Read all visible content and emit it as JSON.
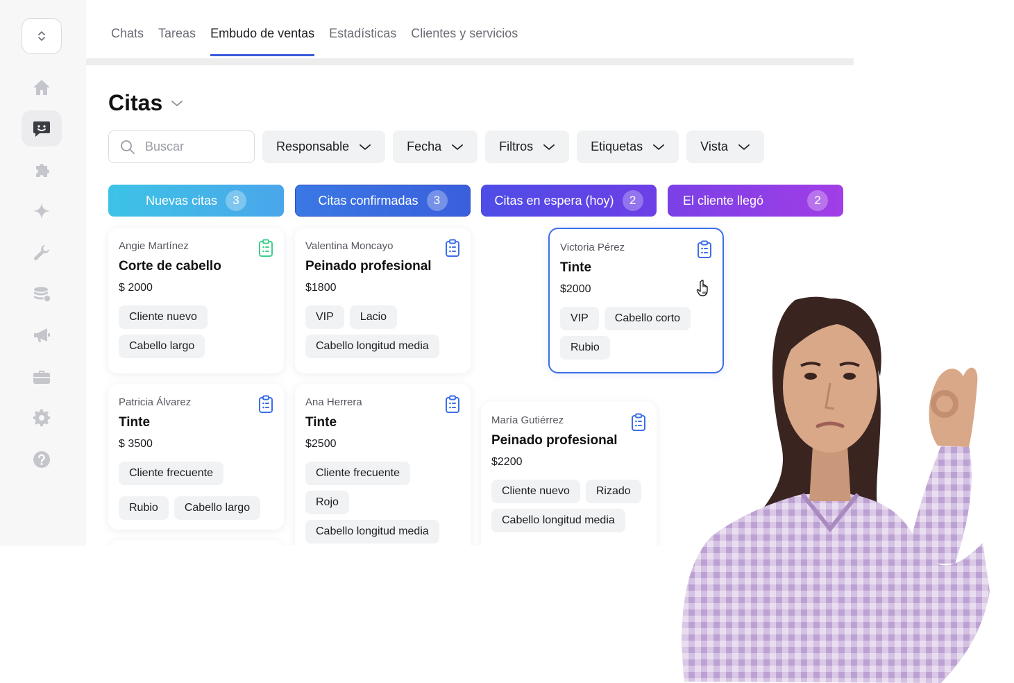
{
  "sidebar": {
    "items": [
      {
        "icon": "home-icon"
      },
      {
        "icon": "chat-icon",
        "active": true
      },
      {
        "icon": "puzzle-icon"
      },
      {
        "icon": "sparkle-icon"
      },
      {
        "icon": "wrench-icon"
      },
      {
        "icon": "coins-icon"
      },
      {
        "icon": "megaphone-icon"
      },
      {
        "icon": "briefcase-icon"
      },
      {
        "icon": "gear-icon"
      },
      {
        "icon": "help-icon"
      }
    ]
  },
  "tabs": [
    {
      "label": "Chats"
    },
    {
      "label": "Tareas"
    },
    {
      "label": "Embudo de ventas",
      "active": true
    },
    {
      "label": "Estadísticas"
    },
    {
      "label": "Clientes y servicios"
    }
  ],
  "page": {
    "title": "Citas"
  },
  "search": {
    "placeholder": "Buscar"
  },
  "filters": [
    "Responsable",
    "Fecha",
    "Filtros",
    "Etiquetas",
    "Vista"
  ],
  "columns": [
    {
      "title": "Nuevas citas",
      "count": "3",
      "color": "#3ec0e4"
    },
    {
      "title": "Citas confirmadas",
      "count": "3",
      "color": "#3a6fe0"
    },
    {
      "title": "Citas en espera (hoy)",
      "count": "2",
      "color": "#5a46e6"
    },
    {
      "title": "El cliente llegó",
      "count": "2",
      "color": "#8e3ee6"
    }
  ],
  "cards": [
    {
      "client": "Angie Martínez",
      "service": "Corte de cabello",
      "price": "$ 2000",
      "tags": [
        "Cliente nuevo",
        "Cabello largo"
      ],
      "clip_color": "#3ecf8e"
    },
    {
      "client": "Valentina Moncayo",
      "service": "Peinado profesional",
      "price": "$1800",
      "tags": [
        "VIP",
        "Lacio",
        "Cabello longitud media"
      ],
      "clip_color": "#3b6ee8"
    },
    {
      "client": "Victoria Pérez",
      "service": "Tinte",
      "price": "$2000",
      "tags": [
        "VIP",
        "Cabello corto",
        "Rubio"
      ],
      "clip_color": "#3b6ee8"
    },
    {
      "client": "Patricia Álvarez",
      "service": "Tinte",
      "price": "$ 3500",
      "tags": [
        "Cliente frecuente",
        "Rubio",
        "Cabello largo"
      ],
      "clip_color": "#3b6ee8"
    },
    {
      "client": "Ana Herrera",
      "service": "Tinte",
      "price": "$2500",
      "tags": [
        "Cliente frecuente",
        "Rojo",
        "Cabello longitud media"
      ],
      "clip_color": "#3b6ee8"
    },
    {
      "client": "María Gutiérrez",
      "service": "Peinado profesional",
      "price": "$2200",
      "tags": [
        "Cliente nuevo",
        "Rizado",
        "Cabello longitud media"
      ],
      "clip_color": "#3b6ee8"
    }
  ]
}
